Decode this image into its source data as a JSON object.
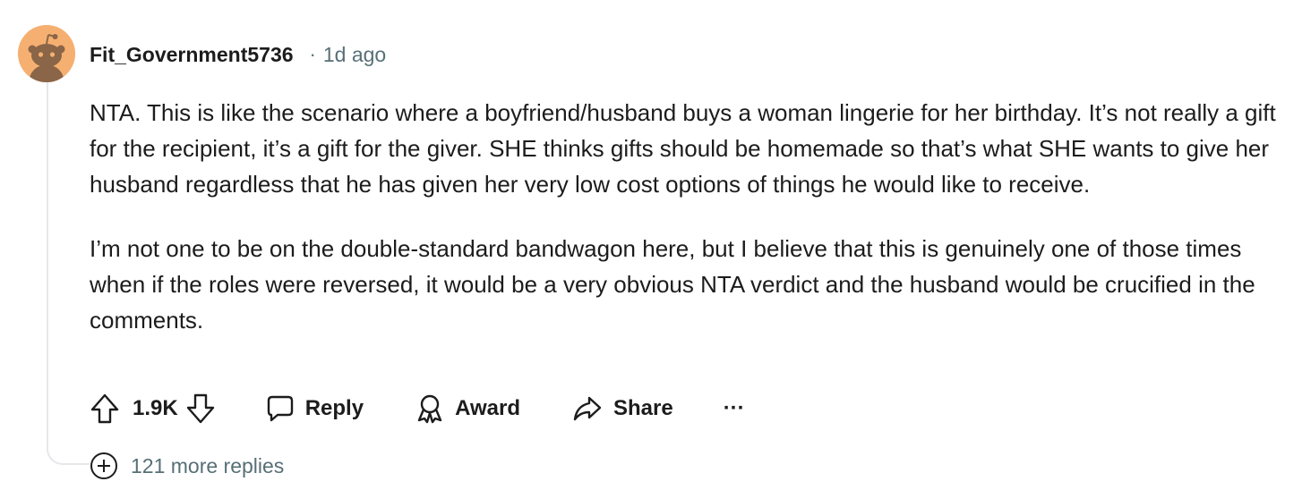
{
  "comment": {
    "username": "Fit_Government5736",
    "separator": "·",
    "timestamp": "1d ago",
    "paragraphs": [
      "NTA. This is like the scenario where a boyfriend/husband buys a woman lingerie for her birthday. It’s not really a gift for the recipient, it’s a gift for the giver. SHE thinks gifts should be homemade so that’s what SHE wants to give her husband regardless that he has given her very low cost options of things he would like to receive.",
      "I’m not one to be on the double-standard bandwagon here, but I believe that this is genuinely one of those times when if the roles were reversed, it would be a very obvious NTA verdict and the husband would be crucified in the comments."
    ]
  },
  "actions": {
    "vote_count": "1.9K",
    "reply_label": "Reply",
    "award_label": "Award",
    "share_label": "Share",
    "more_label": "···"
  },
  "replies": {
    "more_replies_label": "121 more replies"
  },
  "colors": {
    "text": "#1c1c1c",
    "muted": "#576f76",
    "avatar_bg": "#f5b071",
    "thread_line": "#e5e7ea"
  },
  "icons": {
    "upvote": "arrow-up-icon",
    "downvote": "arrow-down-icon",
    "reply": "speech-bubble-icon",
    "award": "award-ribbon-icon",
    "share": "share-arrow-icon",
    "expand": "plus-circle-icon"
  }
}
